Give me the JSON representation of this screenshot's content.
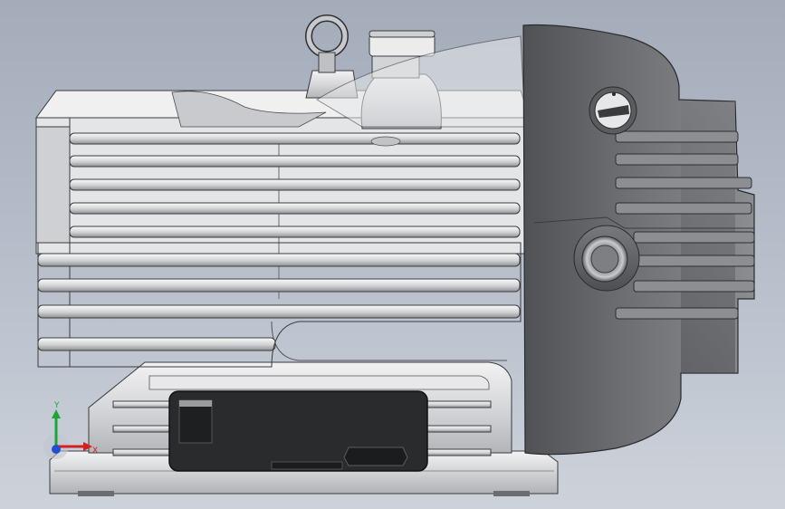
{
  "viewport": {
    "background_top": "#a4acba",
    "background_bottom": "#cdd2da"
  },
  "model": {
    "part": "vacuum-pump",
    "body_color": "#d9dadd",
    "housing_color": "#6a6c70",
    "panel_color": "#2b2c2e"
  },
  "triad": {
    "y_label": "Y",
    "x_label": "X",
    "y_color": "#1fa43a",
    "x_color": "#d42020",
    "z_color": "#2050d0"
  }
}
